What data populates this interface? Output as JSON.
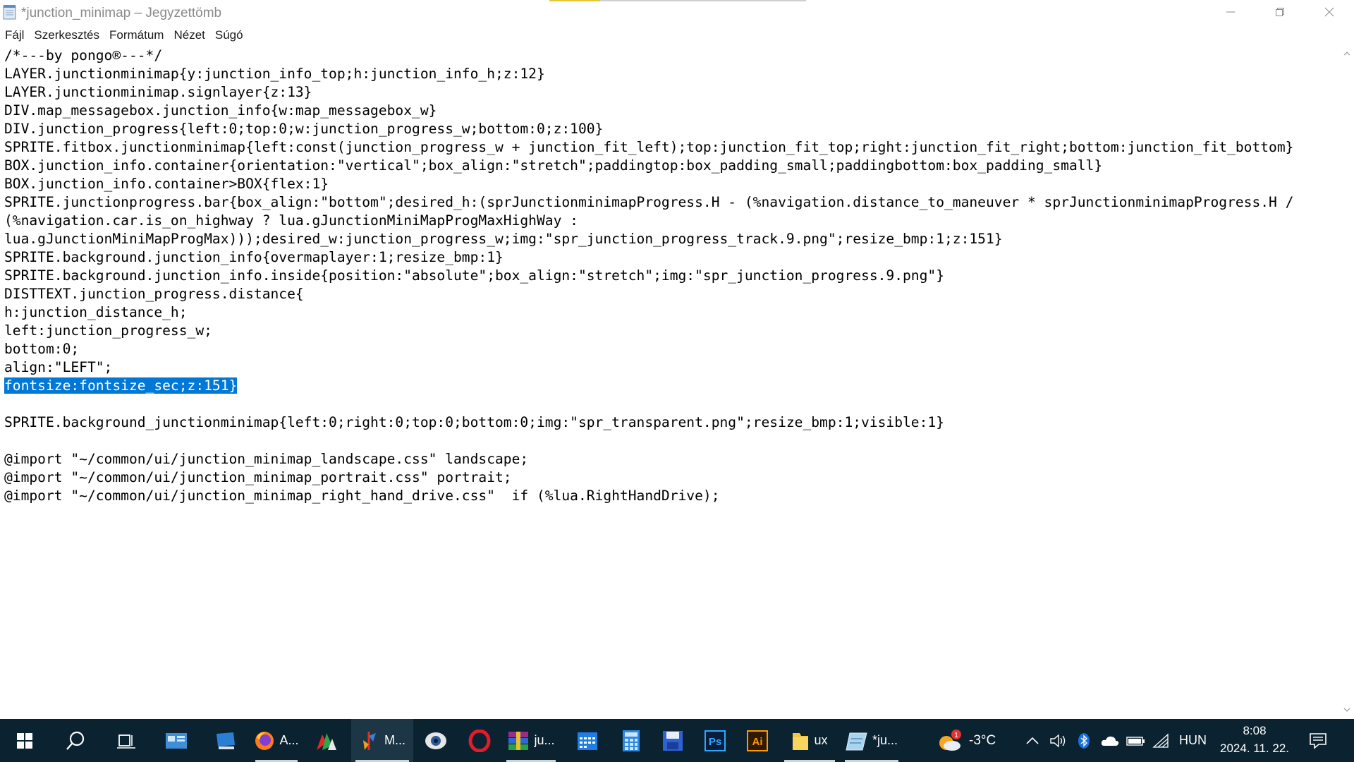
{
  "window": {
    "title": "*junction_minimap – Jegyzettömb",
    "buttons": {
      "minimize": "minimize",
      "maximize": "restore",
      "close": "close"
    }
  },
  "menu": [
    "Fájl",
    "Szerkesztés",
    "Formátum",
    "Nézet",
    "Súgó"
  ],
  "editor": {
    "lines": [
      "/*---by pongo®---*/",
      "LAYER.junctionminimap{y:junction_info_top;h:junction_info_h;z:12}",
      "LAYER.junctionminimap.signlayer{z:13}",
      "DIV.map_messagebox.junction_info{w:map_messagebox_w}",
      "DIV.junction_progress{left:0;top:0;w:junction_progress_w;bottom:0;z:100}",
      "SPRITE.fitbox.junctionminimap{left:const(junction_progress_w + junction_fit_left);top:junction_fit_top;right:junction_fit_right;bottom:junction_fit_bottom}",
      "BOX.junction_info.container{orientation:\"vertical\";box_align:\"stretch\";paddingtop:box_padding_small;paddingbottom:box_padding_small}",
      "BOX.junction_info.container>BOX{flex:1}",
      "SPRITE.junctionprogress.bar{box_align:\"bottom\";desired_h:(sprJunctionminimapProgress.H - (%navigation.distance_to_maneuver * sprJunctionminimapProgress.H /",
      "(%navigation.car.is_on_highway ? lua.gJunctionMiniMapProgMaxHighWay :",
      "lua.gJunctionMiniMapProgMax)));desired_w:junction_progress_w;img:\"spr_junction_progress_track.9.png\";resize_bmp:1;z:151}",
      "SPRITE.background.junction_info{overmaplayer:1;resize_bmp:1}",
      "SPRITE.background.junction_info.inside{position:\"absolute\";box_align:\"stretch\";img:\"spr_junction_progress.9.png\"}",
      "DISTTEXT.junction_progress.distance{",
      "h:junction_distance_h;",
      "left:junction_progress_w;",
      "bottom:0;",
      "align:\"LEFT\";",
      "fontsize:fontsize_sec;z:151}",
      "",
      "SPRITE.background_junctionminimap{left:0;right:0;top:0;bottom:0;img:\"spr_transparent.png\";resize_bmp:1;visible:1}",
      "",
      "@import \"~/common/ui/junction_minimap_landscape.css\" landscape;",
      "@import \"~/common/ui/junction_minimap_portrait.css\" portrait;",
      "@import \"~/common/ui/junction_minimap_right_hand_drive.css\"  if (%lua.RightHandDrive);"
    ],
    "selected_line": 18
  },
  "taskbar": {
    "apps": [
      {
        "icon": "start-icon"
      },
      {
        "icon": "search-icon"
      },
      {
        "icon": "task-view-icon"
      },
      {
        "icon": "control-panel-icon"
      },
      {
        "icon": "computer-icon"
      },
      {
        "icon": "firefox-icon",
        "label": "A..."
      },
      {
        "icon": "app-color-icon"
      },
      {
        "icon": "m-app-icon",
        "label": "M..."
      },
      {
        "icon": "eye-icon"
      },
      {
        "icon": "opera-icon"
      },
      {
        "icon": "winrar-icon",
        "label": "ju..."
      },
      {
        "icon": "calendar-icon"
      },
      {
        "icon": "calculator-icon"
      },
      {
        "icon": "save-disk-icon"
      },
      {
        "icon": "photoshop-icon",
        "text": "Ps"
      },
      {
        "icon": "illustrator-icon",
        "text": "Ai"
      },
      {
        "icon": "folder-icon",
        "label": "ux"
      },
      {
        "icon": "notepad-icon",
        "label": "*ju..."
      }
    ],
    "weather": {
      "temp": "-3°C",
      "badge": "1"
    },
    "tray": {
      "language": "HUN"
    },
    "clock": {
      "time": "8:08",
      "date": "2024. 11. 22."
    },
    "colors": {
      "background": "#0b2230",
      "selection": "#0078d7"
    }
  }
}
